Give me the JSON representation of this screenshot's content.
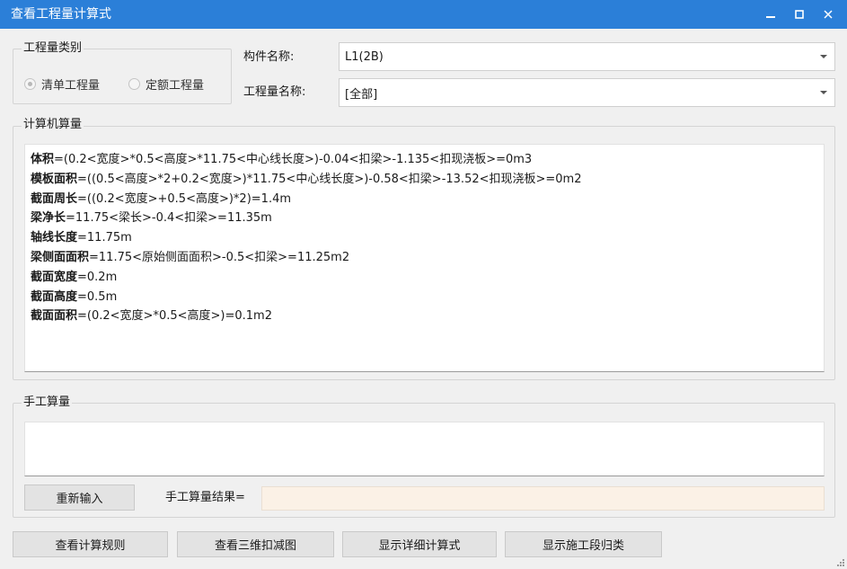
{
  "window": {
    "title": "查看工程量计算式",
    "controls": {
      "minimize": "minimize-icon",
      "maximize": "maximize-icon",
      "close": "close-icon"
    }
  },
  "quantity_type": {
    "legend": "工程量类别",
    "options": [
      {
        "label": "清单工程量",
        "checked": true
      },
      {
        "label": "定额工程量",
        "checked": false
      }
    ]
  },
  "component": {
    "label": "构件名称:",
    "value": "L1(2B)"
  },
  "quantity_name": {
    "label": "工程量名称:",
    "value": "[全部]"
  },
  "computer_calc": {
    "legend": "计算机算量",
    "lines": [
      {
        "key": "体积",
        "expr": "=(0.2<宽度>*0.5<高度>*11.75<中心线长度>)-0.04<扣梁>-1.135<扣现浇板>=0m3"
      },
      {
        "key": "模板面积",
        "expr": "=((0.5<高度>*2+0.2<宽度>)*11.75<中心线长度>)-0.58<扣梁>-13.52<扣现浇板>=0m2"
      },
      {
        "key": "截面周长",
        "expr": "=((0.2<宽度>+0.5<高度>)*2)=1.4m"
      },
      {
        "key": "梁净长",
        "expr": "=11.75<梁长>-0.4<扣梁>=11.35m"
      },
      {
        "key": "轴线长度",
        "expr": "=11.75m"
      },
      {
        "key": "梁侧面面积",
        "expr": "=11.75<原始侧面面积>-0.5<扣梁>=11.25m2"
      },
      {
        "key": "截面宽度",
        "expr": "=0.2m"
      },
      {
        "key": "截面高度",
        "expr": "=0.5m"
      },
      {
        "key": "截面面积",
        "expr": "=(0.2<宽度>*0.5<高度>)=0.1m2"
      }
    ]
  },
  "manual_calc": {
    "legend": "手工算量",
    "reenter_label": "重新输入",
    "result_label": "手工算量结果=",
    "result_value": ""
  },
  "bottom_buttons": {
    "rules": "查看计算规则",
    "view3d": "查看三维扣减图",
    "detail": "显示详细计算式",
    "segment": "显示施工段归类"
  }
}
